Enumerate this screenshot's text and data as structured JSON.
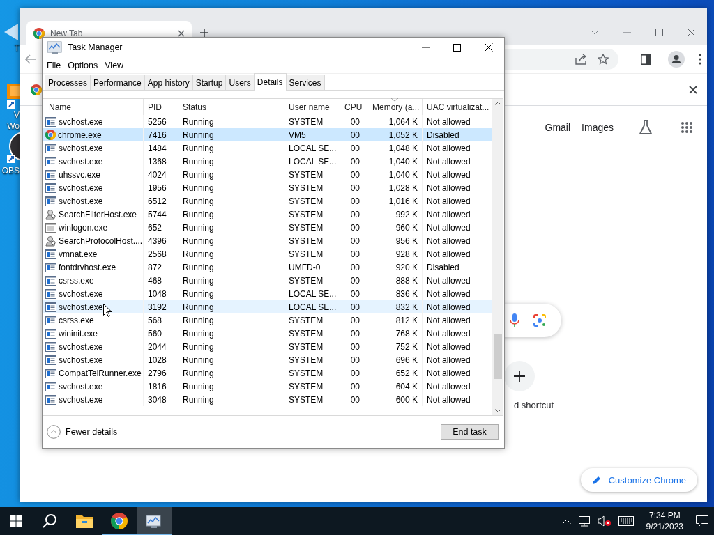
{
  "desktop_icons": [
    {
      "kind": "shortcut",
      "label": "T"
    },
    {
      "kind": "vm",
      "label": "V"
    },
    {
      "kind": "none",
      "label": "Wo"
    },
    {
      "kind": "obs",
      "label": "OBS"
    }
  ],
  "browser": {
    "tabs": [
      {
        "title": "New Tab",
        "selected": true
      }
    ],
    "links": [
      "Gmail",
      "Images"
    ],
    "shortcut_label": "d shortcut",
    "customize_button": "Customize Chrome"
  },
  "task_manager": {
    "title": "Task Manager",
    "menu": [
      "File",
      "Options",
      "View"
    ],
    "tabs": [
      {
        "label": "Processes",
        "selected": false
      },
      {
        "label": "Performance",
        "selected": false
      },
      {
        "label": "App history",
        "selected": false
      },
      {
        "label": "Startup",
        "selected": false
      },
      {
        "label": "Users",
        "selected": false
      },
      {
        "label": "Details",
        "selected": true
      },
      {
        "label": "Services",
        "selected": false
      }
    ],
    "columns": [
      {
        "label": "Name",
        "sorted": false
      },
      {
        "label": "PID",
        "sorted": false
      },
      {
        "label": "Status",
        "sorted": false
      },
      {
        "label": "User name",
        "sorted": false
      },
      {
        "label": "CPU",
        "sorted": false
      },
      {
        "label": "Memory (a...",
        "sorted": true
      },
      {
        "label": "UAC virtualizat...",
        "sorted": false
      }
    ],
    "rows": [
      {
        "kind": "service",
        "name": "svchost.exe",
        "pid": "5256",
        "status": "Running",
        "user": "SYSTEM",
        "cpu": "00",
        "memory": "1,064 K",
        "uac": "Not allowed",
        "selected": false,
        "hovered": false
      },
      {
        "kind": "chrome",
        "name": "chrome.exe",
        "pid": "7416",
        "status": "Running",
        "user": "VM5",
        "cpu": "00",
        "memory": "1,052 K",
        "uac": "Disabled",
        "selected": true,
        "hovered": false
      },
      {
        "kind": "service",
        "name": "svchost.exe",
        "pid": "1484",
        "status": "Running",
        "user": "LOCAL SE...",
        "cpu": "00",
        "memory": "1,048 K",
        "uac": "Not allowed",
        "selected": false,
        "hovered": false
      },
      {
        "kind": "service",
        "name": "svchost.exe",
        "pid": "1368",
        "status": "Running",
        "user": "LOCAL SE...",
        "cpu": "00",
        "memory": "1,040 K",
        "uac": "Not allowed",
        "selected": false,
        "hovered": false
      },
      {
        "kind": "service",
        "name": "uhssvc.exe",
        "pid": "4024",
        "status": "Running",
        "user": "SYSTEM",
        "cpu": "00",
        "memory": "1,040 K",
        "uac": "Not allowed",
        "selected": false,
        "hovered": false
      },
      {
        "kind": "service",
        "name": "svchost.exe",
        "pid": "1956",
        "status": "Running",
        "user": "SYSTEM",
        "cpu": "00",
        "memory": "1,028 K",
        "uac": "Not allowed",
        "selected": false,
        "hovered": false
      },
      {
        "kind": "service",
        "name": "svchost.exe",
        "pid": "6512",
        "status": "Running",
        "user": "SYSTEM",
        "cpu": "00",
        "memory": "1,016 K",
        "uac": "Not allowed",
        "selected": false,
        "hovered": false
      },
      {
        "kind": "search",
        "name": "SearchFilterHost.exe",
        "pid": "5744",
        "status": "Running",
        "user": "SYSTEM",
        "cpu": "00",
        "memory": "992 K",
        "uac": "Not allowed",
        "selected": false,
        "hovered": false
      },
      {
        "kind": "window",
        "name": "winlogon.exe",
        "pid": "652",
        "status": "Running",
        "user": "SYSTEM",
        "cpu": "00",
        "memory": "960 K",
        "uac": "Not allowed",
        "selected": false,
        "hovered": false
      },
      {
        "kind": "search",
        "name": "SearchProtocolHost....",
        "pid": "4396",
        "status": "Running",
        "user": "SYSTEM",
        "cpu": "00",
        "memory": "956 K",
        "uac": "Not allowed",
        "selected": false,
        "hovered": false
      },
      {
        "kind": "service",
        "name": "vmnat.exe",
        "pid": "2568",
        "status": "Running",
        "user": "SYSTEM",
        "cpu": "00",
        "memory": "928 K",
        "uac": "Not allowed",
        "selected": false,
        "hovered": false
      },
      {
        "kind": "service",
        "name": "fontdrvhost.exe",
        "pid": "872",
        "status": "Running",
        "user": "UMFD-0",
        "cpu": "00",
        "memory": "920 K",
        "uac": "Disabled",
        "selected": false,
        "hovered": false
      },
      {
        "kind": "service",
        "name": "csrss.exe",
        "pid": "468",
        "status": "Running",
        "user": "SYSTEM",
        "cpu": "00",
        "memory": "888 K",
        "uac": "Not allowed",
        "selected": false,
        "hovered": false
      },
      {
        "kind": "service",
        "name": "svchost.exe",
        "pid": "1048",
        "status": "Running",
        "user": "LOCAL SE...",
        "cpu": "00",
        "memory": "836 K",
        "uac": "Not allowed",
        "selected": false,
        "hovered": false
      },
      {
        "kind": "service",
        "name": "svchost.exe",
        "pid": "3192",
        "status": "Running",
        "user": "LOCAL SE...",
        "cpu": "00",
        "memory": "832 K",
        "uac": "Not allowed",
        "selected": false,
        "hovered": true
      },
      {
        "kind": "service",
        "name": "csrss.exe",
        "pid": "568",
        "status": "Running",
        "user": "SYSTEM",
        "cpu": "00",
        "memory": "812 K",
        "uac": "Not allowed",
        "selected": false,
        "hovered": false
      },
      {
        "kind": "service",
        "name": "wininit.exe",
        "pid": "560",
        "status": "Running",
        "user": "SYSTEM",
        "cpu": "00",
        "memory": "768 K",
        "uac": "Not allowed",
        "selected": false,
        "hovered": false
      },
      {
        "kind": "service",
        "name": "svchost.exe",
        "pid": "2044",
        "status": "Running",
        "user": "SYSTEM",
        "cpu": "00",
        "memory": "752 K",
        "uac": "Not allowed",
        "selected": false,
        "hovered": false
      },
      {
        "kind": "service",
        "name": "svchost.exe",
        "pid": "1028",
        "status": "Running",
        "user": "SYSTEM",
        "cpu": "00",
        "memory": "696 K",
        "uac": "Not allowed",
        "selected": false,
        "hovered": false
      },
      {
        "kind": "service",
        "name": "CompatTelRunner.exe",
        "pid": "2796",
        "status": "Running",
        "user": "SYSTEM",
        "cpu": "00",
        "memory": "652 K",
        "uac": "Not allowed",
        "selected": false,
        "hovered": false
      },
      {
        "kind": "service",
        "name": "svchost.exe",
        "pid": "1816",
        "status": "Running",
        "user": "SYSTEM",
        "cpu": "00",
        "memory": "604 K",
        "uac": "Not allowed",
        "selected": false,
        "hovered": false
      },
      {
        "kind": "service",
        "name": "svchost.exe",
        "pid": "3048",
        "status": "Running",
        "user": "SYSTEM",
        "cpu": "00",
        "memory": "600 K",
        "uac": "Not allowed",
        "selected": false,
        "hovered": false
      }
    ],
    "fewer_details": "Fewer details",
    "end_task": "End task"
  },
  "taskbar": {
    "apps": [
      {
        "kind": "start",
        "active": false,
        "running": false
      },
      {
        "kind": "search",
        "active": false,
        "running": false
      },
      {
        "kind": "explorer",
        "active": false,
        "running": false
      },
      {
        "kind": "chrome",
        "active": false,
        "running": true
      },
      {
        "kind": "taskmanager",
        "active": true,
        "running": true
      }
    ],
    "clock": {
      "time": "7:34 PM",
      "date": "9/21/2023"
    }
  }
}
